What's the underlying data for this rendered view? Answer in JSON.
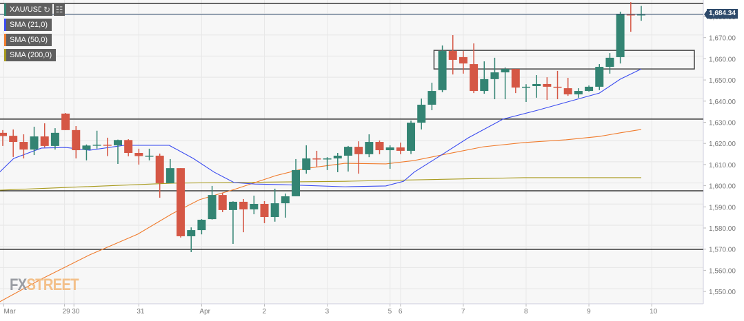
{
  "symbol": "XAU/USD",
  "last_price": "1,684.34",
  "legend": [
    {
      "label": "SMA (21,0)",
      "color": "#3b4cf0"
    },
    {
      "label": "SMA (50,0)",
      "color": "#f07b2c"
    },
    {
      "label": "SMA (200,0)",
      "color": "#a89a1e"
    }
  ],
  "logo": {
    "fx": "FX",
    "street": "STREET"
  },
  "chart_data": {
    "type": "candlestick",
    "ylim": [
      1541,
      1689
    ],
    "y_ticks": [
      "1,550.00",
      "1,560.00",
      "1,570.00",
      "1,580.00",
      "1,590.00",
      "1,600.00",
      "1,610.00",
      "1,620.00",
      "1,630.00",
      "1,640.00",
      "1,650.00",
      "1,660.00",
      "1,670.00",
      "1,680.00"
    ],
    "y_tick_values": [
      1550,
      1560,
      1570,
      1580,
      1590,
      1600,
      1610,
      1620,
      1630,
      1640,
      1650,
      1660,
      1670,
      1680
    ],
    "x_labels": [
      {
        "t": "Mar",
        "i": 0.1
      },
      {
        "t": "29",
        "i": 5.9
      },
      {
        "t": "30",
        "i": 6.8
      },
      {
        "t": "31",
        "i": 13
      },
      {
        "t": "Apr",
        "i": 19
      },
      {
        "t": "2",
        "i": 25
      },
      {
        "t": "3",
        "i": 31
      },
      {
        "t": "5",
        "i": 37
      },
      {
        "t": "6",
        "i": 38
      },
      {
        "t": "7",
        "i": 44
      },
      {
        "t": "8",
        "i": 50
      },
      {
        "t": "9",
        "i": 56
      },
      {
        "t": "10",
        "i": 62
      }
    ],
    "candles": [
      [
        1625,
        1626.3,
        1618.8,
        1623.5
      ],
      [
        1623.6,
        1626.6,
        1613.6,
        1620.7
      ],
      [
        1620.7,
        1624.3,
        1612.9,
        1617.1
      ],
      [
        1617.1,
        1627.9,
        1614.5,
        1623.3
      ],
      [
        1623.3,
        1629.5,
        1618.1,
        1618.8
      ],
      [
        1618.8,
        1627.2,
        1617.1,
        1625
      ],
      [
        1634.1,
        1634.4,
        1626.3,
        1626.3
      ],
      [
        1626.3,
        1628.2,
        1612.9,
        1616.8
      ],
      [
        1617,
        1619.5,
        1612,
        1619
      ],
      [
        1619,
        1626,
        1617.5,
        1619.4
      ],
      [
        1619.4,
        1622.7,
        1614,
        1619.1
      ],
      [
        1619.1,
        1621.8,
        1610.3,
        1621.6
      ],
      [
        1621.6,
        1622,
        1613.9,
        1615.5
      ],
      [
        1615.5,
        1617.5,
        1610,
        1614
      ],
      [
        1614,
        1617.5,
        1612,
        1614.2
      ],
      [
        1614.2,
        1615.2,
        1594.3,
        1601.2
      ],
      [
        1601.2,
        1612.6,
        1601.2,
        1608.3
      ],
      [
        1608.3,
        1608.3,
        1575.5,
        1576.1
      ],
      [
        1576.1,
        1580.3,
        1568.6,
        1579
      ],
      [
        1579,
        1584.2,
        1577,
        1583.9
      ],
      [
        1584.2,
        1599.9,
        1584,
        1595.6
      ],
      [
        1595.6,
        1596.6,
        1587.5,
        1588.5
      ],
      [
        1588.5,
        1592.6,
        1572.5,
        1592.4
      ],
      [
        1592.4,
        1593.7,
        1578,
        1588.8
      ],
      [
        1588.8,
        1595.3,
        1586.5,
        1591.4
      ],
      [
        1591.4,
        1592.7,
        1582.3,
        1585.2
      ],
      [
        1585.2,
        1598.6,
        1583,
        1591.7
      ],
      [
        1591.7,
        1596.3,
        1584.9,
        1595
      ],
      [
        1595,
        1612.6,
        1595,
        1607.4
      ],
      [
        1607.4,
        1619.1,
        1605.7,
        1612.9
      ],
      [
        1612.9,
        1616.5,
        1609,
        1612.6
      ],
      [
        1612.6,
        1613.5,
        1607.4,
        1612.9
      ],
      [
        1612.9,
        1615.5,
        1606.4,
        1614.2
      ],
      [
        1614.2,
        1618.8,
        1606.7,
        1618.4
      ],
      [
        1618.4,
        1621,
        1605.7,
        1614.9
      ],
      [
        1614.9,
        1624.3,
        1613.5,
        1620.7
      ],
      [
        1620.7,
        1621.4,
        1614.9,
        1616.8
      ],
      [
        1616.8,
        1619.1,
        1608,
        1618.1
      ],
      [
        1618.1,
        1620.4,
        1614.9,
        1616.5
      ],
      [
        1616.5,
        1630.8,
        1615,
        1629.8
      ],
      [
        1629.8,
        1641.2,
        1626.6,
        1638.3
      ],
      [
        1638.3,
        1648.7,
        1635.7,
        1644.8
      ],
      [
        1645.2,
        1666.3,
        1644.2,
        1663.7
      ],
      [
        1663.7,
        1671.2,
        1652.6,
        1659.5
      ],
      [
        1660.8,
        1663.7,
        1653,
        1657.8
      ],
      [
        1657.5,
        1667.3,
        1643.8,
        1644.8
      ],
      [
        1644.8,
        1658.8,
        1643.5,
        1650.4
      ],
      [
        1650.4,
        1660.5,
        1640.9,
        1653.6
      ],
      [
        1653.6,
        1655.9,
        1640.9,
        1655.2
      ],
      [
        1655.2,
        1655.2,
        1643.8,
        1646.4
      ],
      [
        1646.4,
        1648,
        1639.6,
        1646.8
      ],
      [
        1647.1,
        1652.3,
        1641.6,
        1648.1
      ],
      [
        1648.1,
        1651.3,
        1640.6,
        1646.8
      ],
      [
        1646.8,
        1654.3,
        1640.9,
        1646.4
      ],
      [
        1646.1,
        1651,
        1642.5,
        1643.2
      ],
      [
        1643.2,
        1646.1,
        1641.6,
        1644.8
      ],
      [
        1644.8,
        1647.4,
        1644.5,
        1646.8
      ],
      [
        1646.8,
        1657.5,
        1645.2,
        1656.2
      ],
      [
        1656.2,
        1662.7,
        1653,
        1660.5
      ],
      [
        1660.8,
        1682.3,
        1657.8,
        1681.3
      ],
      [
        1681,
        1686.8,
        1672.8,
        1680.6
      ],
      [
        1680.6,
        1685,
        1678,
        1681
      ]
    ],
    "sma21": [
      [
        -0.3,
        1606.4
      ],
      [
        1.05,
        1612.9
      ],
      [
        3.7,
        1617.8
      ],
      [
        6,
        1618.1
      ],
      [
        8.3,
        1616.8
      ],
      [
        11.6,
        1619.1
      ],
      [
        15.9,
        1619.1
      ],
      [
        18.2,
        1612.9
      ],
      [
        20.2,
        1606.4
      ],
      [
        22.1,
        1601.5
      ],
      [
        24.1,
        1600.8
      ],
      [
        26.7,
        1600.5
      ],
      [
        32.7,
        1599.5
      ],
      [
        36.6,
        1599.9
      ],
      [
        38.3,
        1602.1
      ],
      [
        39.3,
        1606.4
      ],
      [
        41.9,
        1614.5
      ],
      [
        44.5,
        1622.7
      ],
      [
        47.8,
        1631.5
      ],
      [
        51.1,
        1635.7
      ],
      [
        55.1,
        1641.2
      ],
      [
        57,
        1643.8
      ],
      [
        59,
        1650.4
      ],
      [
        61,
        1655.2
      ]
    ],
    "sma50": [
      [
        -0.3,
        1545.1
      ],
      [
        3.7,
        1555.9
      ],
      [
        8.3,
        1567.3
      ],
      [
        12.9,
        1577.1
      ],
      [
        16.2,
        1586.8
      ],
      [
        18.8,
        1593.4
      ],
      [
        22.1,
        1598.2
      ],
      [
        26.1,
        1604.8
      ],
      [
        28.7,
        1608
      ],
      [
        32.7,
        1610.6
      ],
      [
        36.6,
        1610.3
      ],
      [
        39.3,
        1611.9
      ],
      [
        41.9,
        1614.5
      ],
      [
        45.9,
        1618.4
      ],
      [
        49.8,
        1620.4
      ],
      [
        53.8,
        1621.7
      ],
      [
        57,
        1623.3
      ],
      [
        59,
        1625
      ],
      [
        61,
        1626.6
      ]
    ],
    "sma200": [
      [
        -0.3,
        1597.9
      ],
      [
        16.2,
        1601.2
      ],
      [
        32.7,
        1602.1
      ],
      [
        49.8,
        1603.8
      ],
      [
        61,
        1603.8
      ]
    ],
    "hlines": [
      1686.2,
      1631.5,
      1597.6,
      1569.9
    ],
    "box": {
      "i0": 41.2,
      "i1": 66,
      "top": 1664,
      "bottom": 1655.2
    },
    "colors": {
      "up": "#338473",
      "down": "#d55745"
    }
  }
}
